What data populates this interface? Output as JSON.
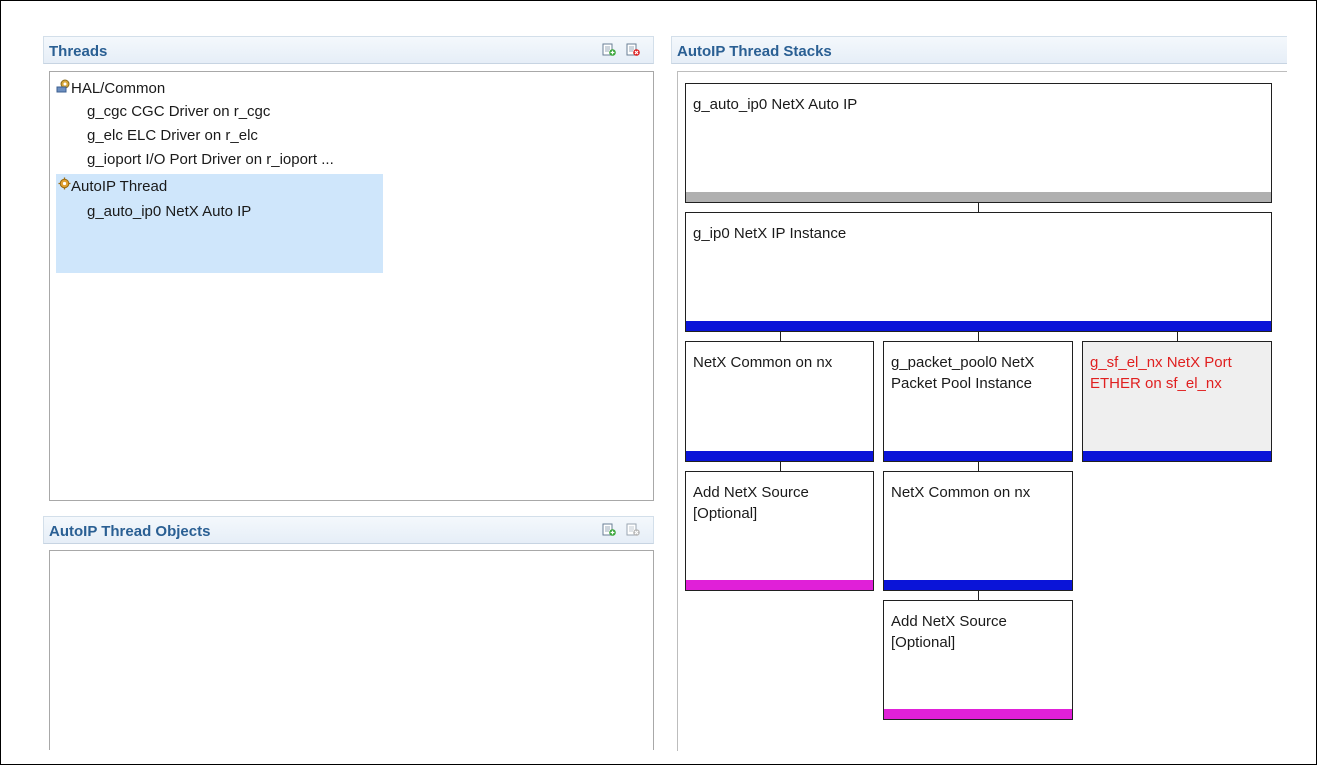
{
  "threads_panel": {
    "title": "Threads",
    "tree": [
      {
        "label": "HAL/Common",
        "icon": "hal-common-icon",
        "level": 0
      },
      {
        "label": "g_cgc CGC Driver on r_cgc",
        "level": 1
      },
      {
        "label": "g_elc ELC Driver on r_elc",
        "level": 1
      },
      {
        "label": "g_ioport I/O Port Driver on r_ioport ...",
        "level": 1
      },
      {
        "label": "AutoIP Thread",
        "icon": "thread-gear-icon",
        "level": 0,
        "selected": true
      },
      {
        "label": "g_auto_ip0 NetX Auto IP",
        "level": 1,
        "selected": true
      }
    ],
    "toolbar_icons": [
      "add-thread-icon",
      "remove-thread-icon"
    ]
  },
  "objects_panel": {
    "title": "AutoIP Thread Objects",
    "toolbar_icons": [
      "add-object-icon",
      "remove-object-icon"
    ]
  },
  "stacks_panel": {
    "title": "AutoIP Thread Stacks",
    "blocks": [
      {
        "label": "g_auto_ip0 NetX Auto IP",
        "bar": "gray"
      },
      {
        "label": "g_ip0 NetX IP Instance",
        "bar": "blue"
      },
      {
        "label": "NetX Common on nx",
        "bar": "blue"
      },
      {
        "label": "g_packet_pool0 NetX Packet Pool Instance",
        "bar": "blue"
      },
      {
        "label": "g_sf_el_nx NetX Port ETHER on sf_el_nx",
        "bar": "blue",
        "error": true
      },
      {
        "label": "Add NetX Source [Optional]",
        "bar": "pink"
      },
      {
        "label": "NetX Common on nx",
        "bar": "blue"
      },
      {
        "label": "Add NetX Source [Optional]",
        "bar": "pink"
      }
    ]
  },
  "colors": {
    "header_title": "#2a5f93",
    "selection": "#cfe6fb",
    "bar_blue": "#0a14d8",
    "bar_gray": "#b0b0b0",
    "bar_pink": "#e020d8",
    "error_text": "#e02020"
  }
}
